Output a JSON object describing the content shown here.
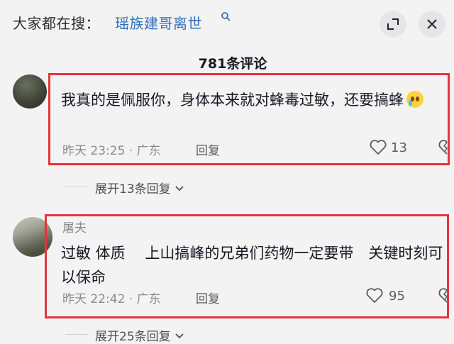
{
  "search": {
    "prefix": "大家都在搜：",
    "term": "瑶族建哥离世"
  },
  "comments_count": "781条评论",
  "comments": [
    {
      "username": "",
      "text": "我真的是佩服你，身体本来就对蜂毒过敏，还要搞蜂",
      "emoji": "crying-face-emoji",
      "time": "昨天 23:25 · 广东",
      "reply_label": "回复",
      "likes": "13",
      "expand_label": "展开13条回复"
    },
    {
      "username": "屠夫",
      "text": "过敏 体质　 上山搞峰的兄弟们药物一定要带　关键时刻可以保命",
      "time": "昨天 22:42 · 广东",
      "reply_label": "回复",
      "likes": "95",
      "expand_label": "展开25条回复"
    }
  ],
  "colors": {
    "highlight": "#e8333d",
    "search_term": "#2f6fba"
  },
  "icons": [
    "search-icon",
    "expand-icon",
    "close-icon",
    "heart-icon",
    "broken-heart-icon",
    "chevron-down-icon"
  ]
}
